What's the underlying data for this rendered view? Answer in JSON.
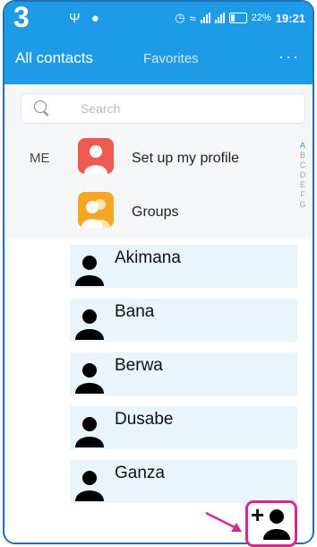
{
  "status": {
    "notification_count": "3",
    "battery_percent": "22%",
    "time": "19:21"
  },
  "header": {
    "tabs": [
      "All contacts",
      "Favorites"
    ],
    "more_label": "···"
  },
  "search": {
    "placeholder": "Search"
  },
  "me_section": {
    "label": "ME",
    "profile_label": "Set up my profile",
    "groups_label": "Groups"
  },
  "index": [
    "A",
    "B",
    "C",
    "D",
    "E",
    "F",
    "G"
  ],
  "contacts": [
    "Akimana",
    "Bana",
    "Berwa",
    "Dusabe",
    "Ganza"
  ],
  "colors": {
    "accent": "#1e9be6",
    "highlight": "#d62a8a"
  }
}
